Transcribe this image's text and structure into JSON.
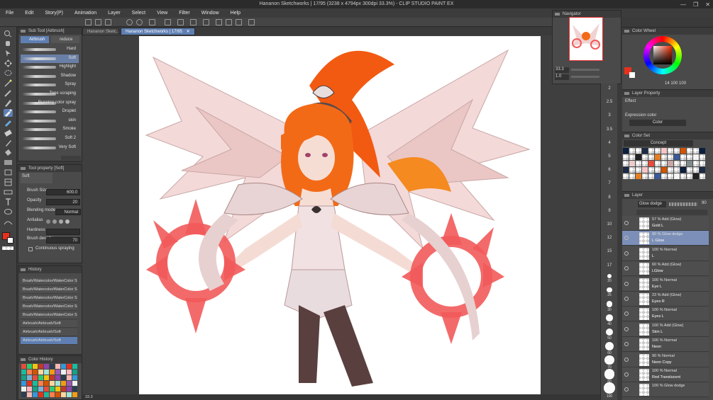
{
  "window": {
    "title": "Hananon Sketchworks | 17/95 (3238 x 4794px 300dpi 33.3%) - CLIP STUDIO PAINT EX",
    "controls": [
      "—",
      "❐",
      "✕"
    ]
  },
  "menu": [
    "File",
    "Edit",
    "Story(P)",
    "Animation",
    "Layer",
    "Select",
    "View",
    "Filter",
    "Window",
    "Help"
  ],
  "tabs": [
    {
      "label": "Hananon Sketc..."
    },
    {
      "label": "Hananon Sketchworks | 17/95",
      "close": "✕"
    }
  ],
  "subtool": {
    "title": "Sub Tool [Airbrush]",
    "tabs": [
      "Airbrush",
      "reduce"
    ],
    "brushes": [
      "Hard",
      "Soft",
      "Highlight",
      "Shadow",
      "Spray",
      "Tone scraping",
      "Running color spray",
      "Droplet",
      "skin",
      "Smoke",
      "Soft 2",
      "Very Soft"
    ],
    "selected_index": 1
  },
  "toolprop": {
    "title": "Tool property [Soft]",
    "preset": "Soft",
    "rows": [
      {
        "label": "Brush Size",
        "value": "600.0"
      },
      {
        "label": "Opacity",
        "value": "20"
      },
      {
        "label": "Blending mode",
        "value": "Normal"
      },
      {
        "label": "Antialias",
        "value": ""
      },
      {
        "label": "Hardness",
        "value": ""
      },
      {
        "label": "Brush density",
        "value": "70"
      }
    ],
    "continuous": "Continuous spraying"
  },
  "history": {
    "title": "History",
    "items": [
      "Brush/Watercolor/WaterColor Sai",
      "Brush/Watercolor/WaterColor Sai",
      "Brush/Watercolor/WaterColor Sai",
      "Brush/Watercolor/WaterColor Sai",
      "Brush/Watercolor/WaterColor Sai",
      "Airbrush/Airbrush/Soft",
      "Airbrush/Airbrush/Soft",
      "Airbrush/Airbrush/Soft"
    ],
    "selected_index": 7
  },
  "colorhist": {
    "title": "Color History"
  },
  "navigator": {
    "title": "Navigator",
    "zoom": "33.3",
    "angle": "1.0"
  },
  "ruler_ticks": [
    "2",
    "2.5",
    "3",
    "3.5",
    "4",
    "5",
    "6",
    "7",
    "8",
    "9",
    "10",
    "12",
    "15",
    "17",
    "20",
    "25",
    "30",
    "40",
    "50",
    "60",
    "70",
    "80",
    "100"
  ],
  "colorwheel": {
    "title": "Color Wheel",
    "values": "14  100  100"
  },
  "layerprop": {
    "title": "Layer Property",
    "effect": "Effect",
    "expression_label": "Expression color",
    "expression_value": "Color"
  },
  "colorset": {
    "title": "Color Set",
    "set_name": "Concept"
  },
  "layers": {
    "title": "Layer",
    "blend_mode": "Glow dodge",
    "opacity": "90",
    "items": [
      {
        "mode": "57 % Add (Glow)",
        "name": "Gold L"
      },
      {
        "mode": "90 % Glow dodge",
        "name": "L Glow"
      },
      {
        "mode": "100 % Normal",
        "name": "L"
      },
      {
        "mode": "60 % Add (Glow)",
        "name": "LGlow"
      },
      {
        "mode": "100 % Normal",
        "name": "Eye L"
      },
      {
        "mode": "23 % Add (Glow)",
        "name": "Eyes R"
      },
      {
        "mode": "100 % Normal",
        "name": "Eyes L"
      },
      {
        "mode": "100 % Add (Glow)",
        "name": "Skin L"
      },
      {
        "mode": "100 % Normal",
        "name": "Neon"
      },
      {
        "mode": "90 % Normal",
        "name": "Neon Copy"
      },
      {
        "mode": "100 % Normal",
        "name": "Red Translucent"
      },
      {
        "mode": "100 % Glow dodge",
        "name": ""
      }
    ],
    "selected_index": 1
  },
  "status": {
    "zoom": "33.3"
  },
  "colors": {
    "main": "#e8311d",
    "sub": "#ffffff",
    "accent": "#5f7fb3",
    "selection": "#7b8fb8"
  }
}
